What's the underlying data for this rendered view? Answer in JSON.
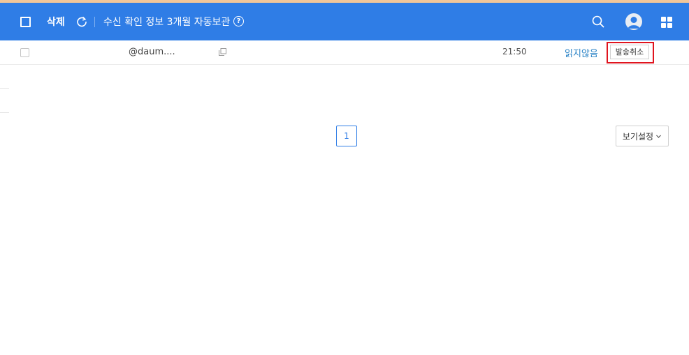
{
  "toolbar": {
    "delete_label": "삭제",
    "info_text": "수신 확인 정보 3개월 자동보관",
    "help_glyph": "?",
    "accent_color": "#2f7de6"
  },
  "icons": {
    "select_all": "checkbox-icon",
    "refresh": "refresh-icon",
    "help": "help-icon",
    "search": "search-icon",
    "profile": "avatar-icon",
    "apps": "grid-icon",
    "copy": "copy-icon",
    "chevron": "chevron-down-icon"
  },
  "mail_list": {
    "rows": [
      {
        "sender": "@daum....",
        "time": "21:50",
        "status": "읽지않음",
        "cancel_label": "발송취소"
      }
    ]
  },
  "pagination": {
    "current_page": "1"
  },
  "view_settings": {
    "label": "보기설정"
  }
}
